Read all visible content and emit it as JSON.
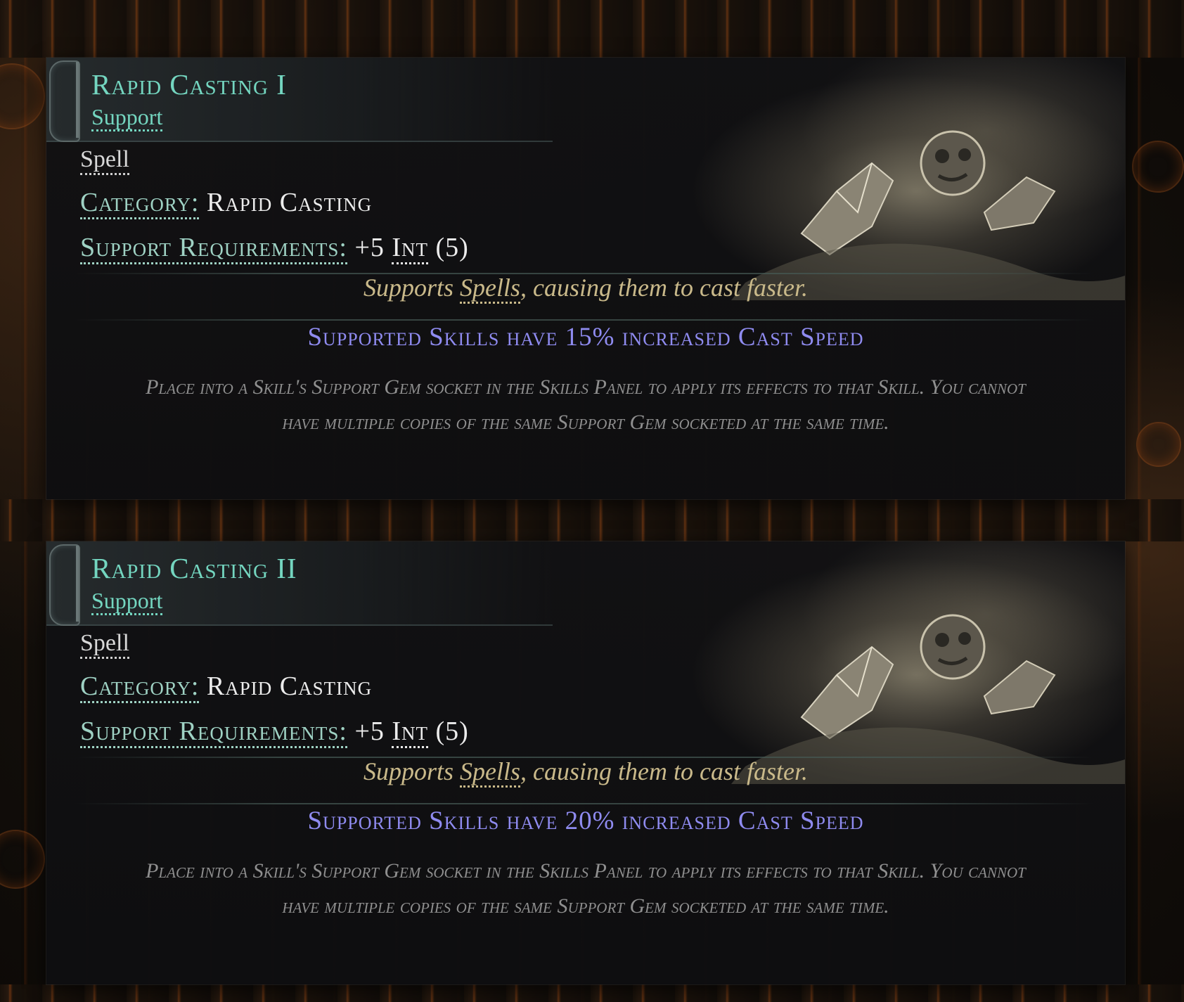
{
  "tooltips": [
    {
      "name": "Rapid Casting I",
      "type": "Support",
      "tag": "Spell",
      "category_label": "Category:",
      "category_value": "Rapid Casting",
      "req_label": "Support Requirements:",
      "req_value": "+5",
      "req_stat": "Int",
      "req_total": "(5)",
      "desc_prefix": "Supports ",
      "desc_keyword": "Spells",
      "desc_suffix": ", causing them to cast faster.",
      "modifier": "Supported Skills have 15% increased Cast Speed",
      "help": "Place into a Skill's Support Gem socket in the Skills Panel to apply its effects to that Skill. You cannot have multiple copies of the same Support Gem socketed at the same time."
    },
    {
      "name": "Rapid Casting II",
      "type": "Support",
      "tag": "Spell",
      "category_label": "Category:",
      "category_value": "Rapid Casting",
      "req_label": "Support Requirements:",
      "req_value": "+5",
      "req_stat": "Int",
      "req_total": "(5)",
      "desc_prefix": "Supports ",
      "desc_keyword": "Spells",
      "desc_suffix": ", causing them to cast faster.",
      "modifier": "Supported Skills have 20% increased Cast Speed",
      "help": "Place into a Skill's Support Gem socket in the Skills Panel to apply its effects to that Skill. You cannot have multiple copies of the same Support Gem socketed at the same time."
    }
  ],
  "colors": {
    "gem_name": "#74d6c0",
    "label": "#9fd2c4",
    "description": "#c9b98a",
    "modifier": "#8f8bf0",
    "help": "#8f8f8f"
  },
  "icons": [
    "gem-art-illustration",
    "header-ornament-icon"
  ]
}
